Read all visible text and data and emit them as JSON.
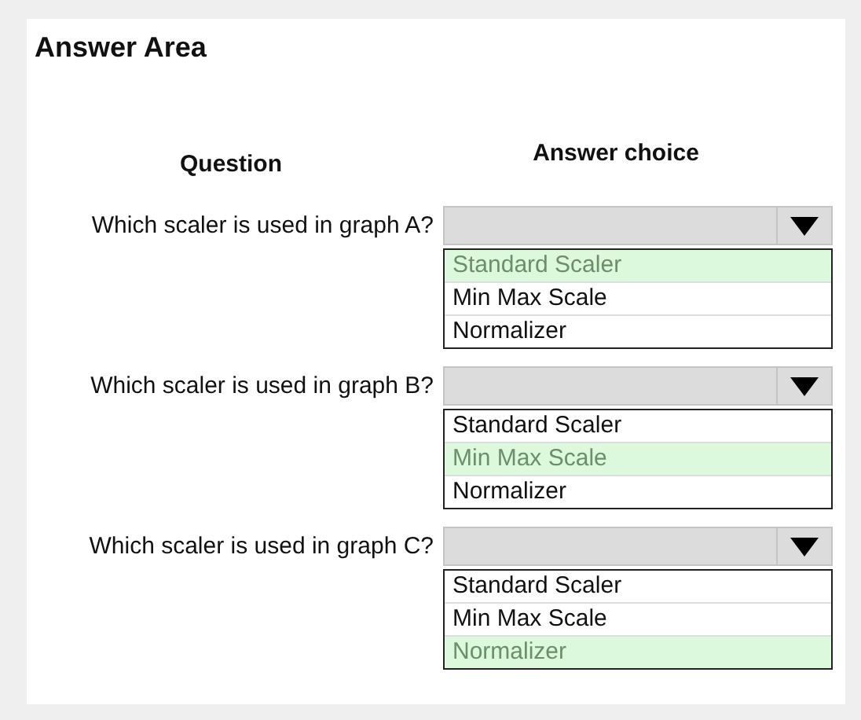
{
  "title": "Answer Area",
  "headers": {
    "question": "Question",
    "answer": "Answer choice"
  },
  "questions": [
    {
      "text": "Which scaler is used in graph A?",
      "options": [
        {
          "label": "Standard Scaler",
          "selected": true
        },
        {
          "label": "Min Max Scale",
          "selected": false
        },
        {
          "label": "Normalizer",
          "selected": false
        }
      ]
    },
    {
      "text": "Which scaler is used in graph B?",
      "options": [
        {
          "label": "Standard Scaler",
          "selected": false
        },
        {
          "label": "Min Max Scale",
          "selected": true
        },
        {
          "label": "Normalizer",
          "selected": false
        }
      ]
    },
    {
      "text": "Which scaler is used in graph C?",
      "options": [
        {
          "label": "Standard Scaler",
          "selected": false
        },
        {
          "label": "Min Max Scale",
          "selected": false
        },
        {
          "label": "Normalizer",
          "selected": true
        }
      ]
    }
  ]
}
